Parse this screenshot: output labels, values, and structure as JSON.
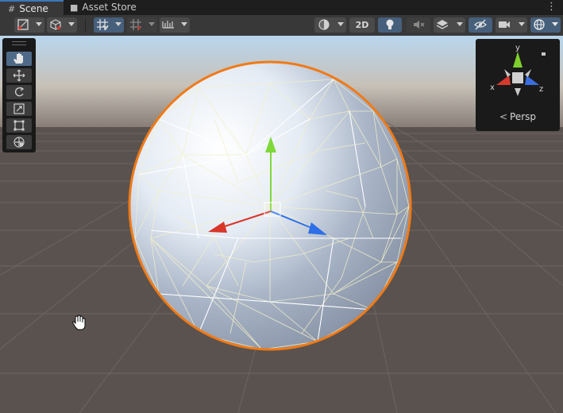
{
  "tabs": [
    {
      "label": "Scene",
      "icon": "grid-icon",
      "active": true
    },
    {
      "label": "Asset Store",
      "icon": "shopping-bag-icon",
      "active": false
    }
  ],
  "window_menu_icon": "more-vertical-icon",
  "toolbar": {
    "left": [
      {
        "name": "shading-mode-dropdown",
        "icon": "shaded-wireframe-icon"
      },
      {
        "name": "draw-mode-dropdown",
        "icon": "cube-icon"
      },
      {
        "name": "grid-snapping-toggle",
        "icon": "grid-snap-icon",
        "active": true
      },
      {
        "name": "grid-size-dropdown",
        "icon": "grid-icon"
      },
      {
        "name": "increment-snapping-dropdown",
        "icon": "ruler-icon"
      }
    ],
    "right": {
      "render_mode": "sphere-shading-icon",
      "mode_2d_label": "2D",
      "lighting": "lightbulb-icon",
      "audio": "audio-muted-icon",
      "effects": "layers-icon",
      "hidden_objects": "eye-off-icon",
      "camera": "camera-icon",
      "gizmos": "globe-icon"
    },
    "accent": "#46607c"
  },
  "tools": [
    {
      "name": "hand-tool",
      "icon": "hand-icon",
      "selected": true
    },
    {
      "name": "move-tool",
      "icon": "move-icon",
      "selected": false
    },
    {
      "name": "rotate-tool",
      "icon": "rotate-icon",
      "selected": false
    },
    {
      "name": "scale-tool",
      "icon": "scale-icon",
      "selected": false
    },
    {
      "name": "rect-tool",
      "icon": "rect-transform-icon",
      "selected": false
    },
    {
      "name": "transform-tool",
      "icon": "transform-icon",
      "selected": false
    }
  ],
  "orientation_gizmo": {
    "axes": [
      {
        "label": "y",
        "color": "#7fcf2c"
      },
      {
        "label": "x",
        "color": "#d63a2e"
      },
      {
        "label": "z",
        "color": "#3a6ee0"
      }
    ],
    "projection_label": "Persp",
    "projection_icon": "perspective-icon"
  },
  "scene": {
    "object": "icosphere",
    "selection_outline_color": "#f07a16",
    "wireframe_color": "#f3f0c8",
    "handles": [
      {
        "axis": "x",
        "color": "#d9352a"
      },
      {
        "axis": "y",
        "color": "#7fd83a"
      },
      {
        "axis": "z",
        "color": "#2e6fe8"
      }
    ]
  },
  "cursor": "hand-cursor-icon"
}
